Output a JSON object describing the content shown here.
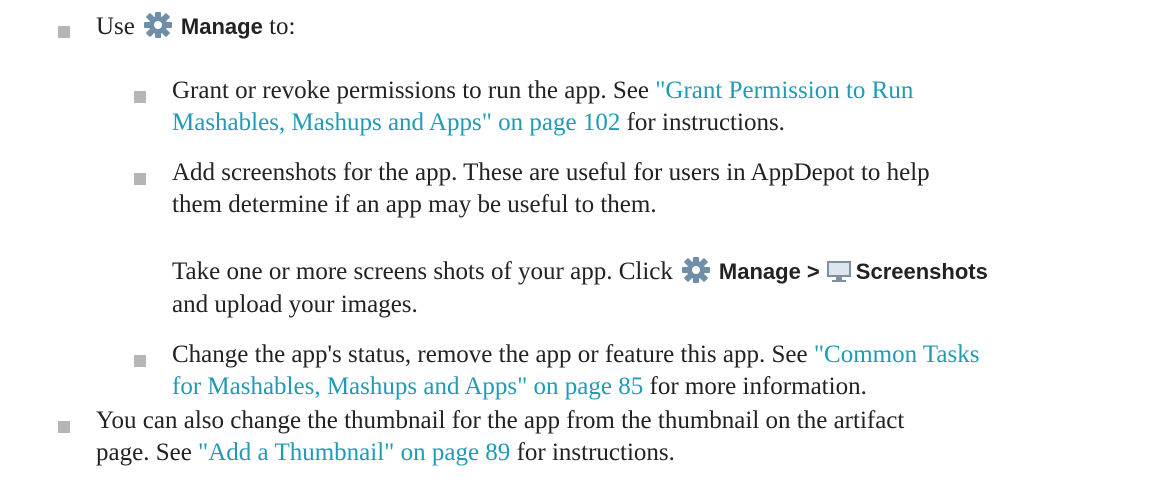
{
  "item1": {
    "prefix": "Use",
    "manage_label": "Manage",
    "suffix": "to:",
    "icon": "gear-icon"
  },
  "sub1": {
    "line1_text": "Grant or revoke permissions to run the app. See ",
    "line1_link": "\"Grant Permission to Run",
    "line2_link": "Mashables, Mashups and Apps\" on page 102",
    "line2_text": " for instructions."
  },
  "sub2": {
    "line1": "Add screenshots for the app. These are useful for users in AppDepot to help",
    "line2": "them determine if an app may be useful to them.",
    "para_prefix": "Take one or more screens shots of your app. Click",
    "para_manage": "Manage >",
    "para_screenshots": "Screenshots",
    "para_line2": "and upload your images.",
    "icons": [
      "gear-icon",
      "monitor-icon"
    ]
  },
  "sub3": {
    "line1_text": "Change the app's status, remove the app or feature this app. See ",
    "line1_link": "\"Common Tasks",
    "line2_link": "for Mashables, Mashups and Apps\" on page 85",
    "line2_text": " for more information."
  },
  "item2": {
    "line1": "You can also change the thumbnail for the app from the thumbnail on the artifact",
    "line2_text1": "page. See ",
    "line2_link": "\"Add a Thumbnail\" on page 89",
    "line2_text2": " for instructions."
  },
  "colors": {
    "link": "#1f9bb6",
    "bullet": "#b5b5b5",
    "text": "#222222"
  }
}
